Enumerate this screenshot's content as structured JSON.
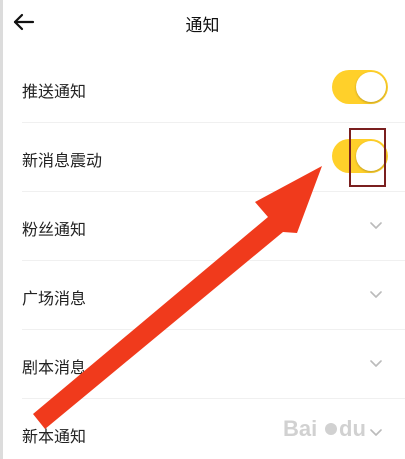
{
  "header": {
    "title": "通知",
    "back_icon": "arrow-left-icon"
  },
  "settings": [
    {
      "label": "推送通知",
      "control": "toggle",
      "on": true
    },
    {
      "label": "新消息震动",
      "control": "toggle",
      "on": true
    },
    {
      "label": "粉丝通知",
      "control": "expand",
      "icon": "chevron-down-icon"
    },
    {
      "label": "广场消息",
      "control": "expand",
      "icon": "chevron-down-icon"
    },
    {
      "label": "剧本消息",
      "control": "expand",
      "icon": "chevron-down-icon"
    },
    {
      "label": "新本通知",
      "control": "expand",
      "icon": "chevron-down-icon"
    }
  ],
  "colors": {
    "toggle_on": "#ffd02a",
    "annotation_arrow": "#f03a1c",
    "highlight_box": "#7a1f1f"
  },
  "watermark": {
    "brand": "Baidu"
  }
}
